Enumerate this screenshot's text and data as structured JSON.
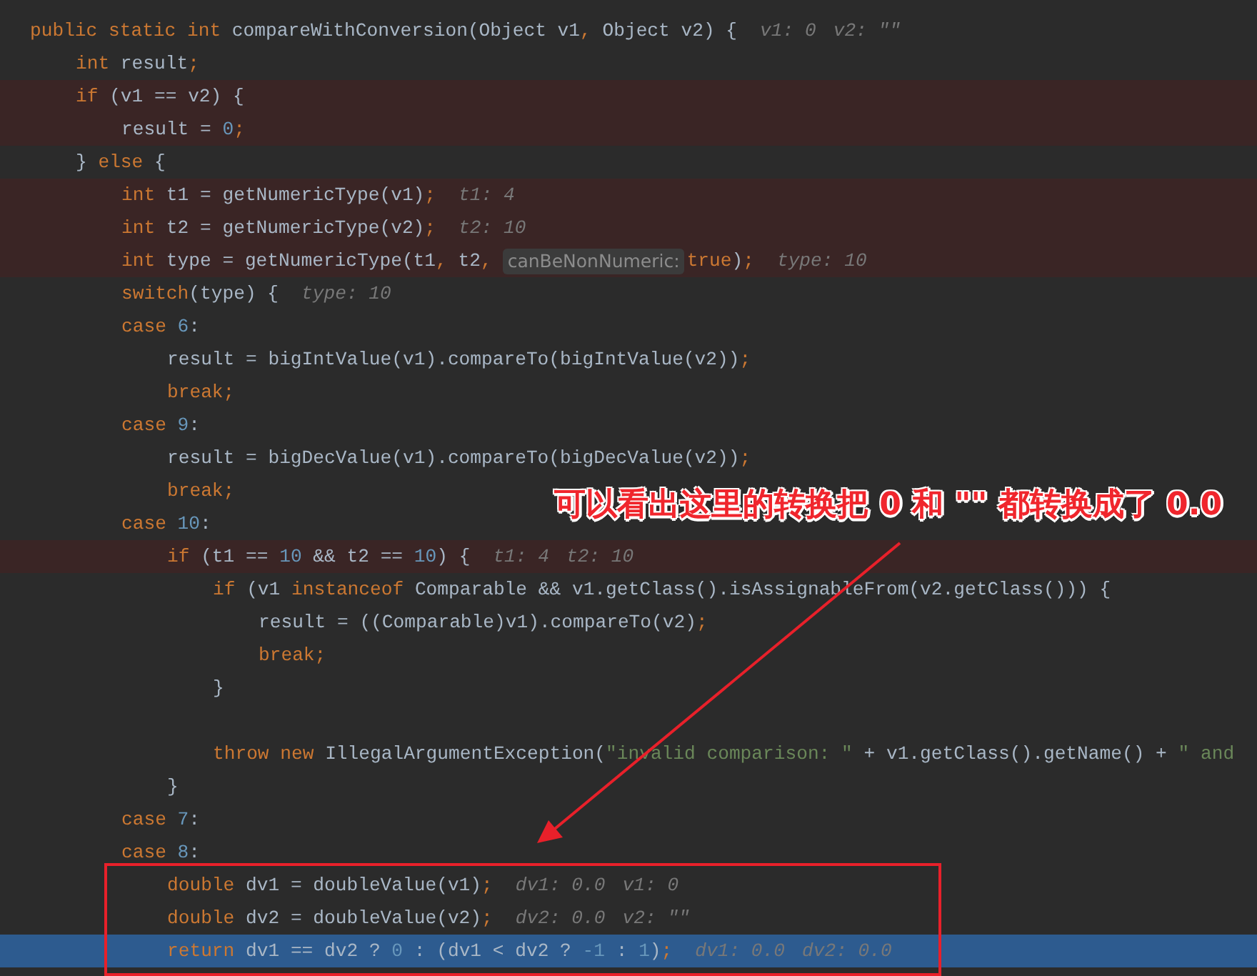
{
  "code": {
    "lines": [
      {
        "kind": "code",
        "highlighted": false,
        "selected": false,
        "tokens": [
          {
            "kind": "kw",
            "text": "public static int"
          },
          {
            "kind": "pl",
            "text": " compareWithConversion(Object v1"
          },
          {
            "kind": "kw",
            "text": ","
          },
          {
            "kind": "pl",
            "text": " Object v2) {"
          }
        ],
        "hints": [
          "v1: 0",
          "v2: \"\""
        ],
        "children": [
          {
            "kind": "code",
            "highlighted": false,
            "selected": false,
            "tokens": [
              {
                "kind": "kw",
                "text": "int"
              },
              {
                "kind": "pl",
                "text": " result"
              },
              {
                "kind": "kw",
                "text": ";"
              }
            ]
          },
          {
            "kind": "code",
            "highlighted": true,
            "selected": false,
            "tokens": [
              {
                "kind": "kw",
                "text": "if"
              },
              {
                "kind": "pl",
                "text": " (v1 == v2) {"
              }
            ],
            "children": [
              {
                "kind": "code",
                "highlighted": true,
                "selected": false,
                "tokens": [
                  {
                    "kind": "pl",
                    "text": "result = "
                  },
                  {
                    "kind": "num",
                    "text": "0"
                  },
                  {
                    "kind": "kw",
                    "text": ";"
                  }
                ]
              }
            ]
          },
          {
            "kind": "code",
            "highlighted": false,
            "selected": false,
            "tokens": [
              {
                "kind": "pl",
                "text": "} "
              },
              {
                "kind": "kw",
                "text": "else"
              },
              {
                "kind": "pl",
                "text": " {"
              }
            ],
            "children": [
              {
                "kind": "code",
                "highlighted": true,
                "selected": false,
                "tokens": [
                  {
                    "kind": "kw",
                    "text": "int"
                  },
                  {
                    "kind": "pl",
                    "text": " t1 = getNumericType(v1)"
                  },
                  {
                    "kind": "kw",
                    "text": ";"
                  }
                ],
                "hints": [
                  "t1: 4"
                ]
              },
              {
                "kind": "code",
                "highlighted": true,
                "selected": false,
                "tokens": [
                  {
                    "kind": "kw",
                    "text": "int"
                  },
                  {
                    "kind": "pl",
                    "text": " t2 = getNumericType(v2)"
                  },
                  {
                    "kind": "kw",
                    "text": ";"
                  }
                ],
                "hints": [
                  "t2: 10"
                ]
              },
              {
                "kind": "code",
                "highlighted": true,
                "selected": false,
                "tokens": [
                  {
                    "kind": "kw",
                    "text": "int"
                  },
                  {
                    "kind": "pl",
                    "text": " type = getNumericType(t1"
                  },
                  {
                    "kind": "kw",
                    "text": ","
                  },
                  {
                    "kind": "pl",
                    "text": " t2"
                  },
                  {
                    "kind": "kw",
                    "text": ","
                  },
                  {
                    "kind": "param",
                    "text": "canBeNonNumeric:"
                  },
                  {
                    "kind": "kw",
                    "text": "true"
                  },
                  {
                    "kind": "pl",
                    "text": ")"
                  },
                  {
                    "kind": "kw",
                    "text": ";"
                  }
                ],
                "hints": [
                  "type: 10"
                ]
              },
              {
                "kind": "code",
                "highlighted": false,
                "selected": false,
                "tokens": [
                  {
                    "kind": "kw",
                    "text": "switch"
                  },
                  {
                    "kind": "pl",
                    "text": "(type) {"
                  }
                ],
                "hints": [
                  "type: 10"
                ]
              },
              {
                "kind": "code",
                "highlighted": false,
                "selected": false,
                "tokens": [
                  {
                    "kind": "kw",
                    "text": "case"
                  },
                  {
                    "kind": "num",
                    "text": " 6"
                  },
                  {
                    "kind": "pl",
                    "text": ":"
                  }
                ],
                "children": [
                  {
                    "kind": "code",
                    "highlighted": false,
                    "selected": false,
                    "tokens": [
                      {
                        "kind": "pl",
                        "text": "result = bigIntValue(v1).compareTo(bigIntValue(v2))"
                      },
                      {
                        "kind": "kw",
                        "text": ";"
                      }
                    ]
                  },
                  {
                    "kind": "code",
                    "highlighted": false,
                    "selected": false,
                    "tokens": [
                      {
                        "kind": "kw",
                        "text": "break;"
                      }
                    ]
                  }
                ]
              },
              {
                "kind": "code",
                "highlighted": false,
                "selected": false,
                "tokens": [
                  {
                    "kind": "kw",
                    "text": "case"
                  },
                  {
                    "kind": "num",
                    "text": " 9"
                  },
                  {
                    "kind": "pl",
                    "text": ":"
                  }
                ],
                "children": [
                  {
                    "kind": "code",
                    "highlighted": false,
                    "selected": false,
                    "tokens": [
                      {
                        "kind": "pl",
                        "text": "result = bigDecValue(v1).compareTo(bigDecValue(v2))"
                      },
                      {
                        "kind": "kw",
                        "text": ";"
                      }
                    ]
                  },
                  {
                    "kind": "code",
                    "highlighted": false,
                    "selected": false,
                    "tokens": [
                      {
                        "kind": "kw",
                        "text": "break;"
                      }
                    ]
                  }
                ]
              },
              {
                "kind": "code",
                "highlighted": false,
                "selected": false,
                "tokens": [
                  {
                    "kind": "kw",
                    "text": "case"
                  },
                  {
                    "kind": "num",
                    "text": " 10"
                  },
                  {
                    "kind": "pl",
                    "text": ":"
                  }
                ],
                "children": [
                  {
                    "kind": "code",
                    "highlighted": true,
                    "selected": false,
                    "tokens": [
                      {
                        "kind": "kw",
                        "text": "if"
                      },
                      {
                        "kind": "pl",
                        "text": " (t1 == "
                      },
                      {
                        "kind": "num",
                        "text": "10"
                      },
                      {
                        "kind": "pl",
                        "text": " && t2 == "
                      },
                      {
                        "kind": "num",
                        "text": "10"
                      },
                      {
                        "kind": "pl",
                        "text": ") {"
                      }
                    ],
                    "hints": [
                      "t1: 4",
                      "t2: 10"
                    ],
                    "children": [
                      {
                        "kind": "code",
                        "highlighted": false,
                        "selected": false,
                        "tokens": [
                          {
                            "kind": "kw",
                            "text": "if"
                          },
                          {
                            "kind": "pl",
                            "text": " (v1 "
                          },
                          {
                            "kind": "kw",
                            "text": "instanceof"
                          },
                          {
                            "kind": "pl",
                            "text": " Comparable && v1.getClass().isAssignableFrom(v2.getClass())) {"
                          }
                        ],
                        "children": [
                          {
                            "kind": "code",
                            "highlighted": false,
                            "selected": false,
                            "tokens": [
                              {
                                "kind": "pl",
                                "text": "result = ((Comparable)v1).compareTo(v2)"
                              },
                              {
                                "kind": "kw",
                                "text": ";"
                              }
                            ]
                          },
                          {
                            "kind": "code",
                            "highlighted": false,
                            "selected": false,
                            "tokens": [
                              {
                                "kind": "kw",
                                "text": "break;"
                              }
                            ]
                          }
                        ]
                      },
                      {
                        "kind": "code",
                        "highlighted": false,
                        "selected": false,
                        "tokens": [
                          {
                            "kind": "pl",
                            "text": "}"
                          }
                        ]
                      },
                      {
                        "kind": "blank"
                      },
                      {
                        "kind": "code",
                        "highlighted": false,
                        "selected": false,
                        "tokens": [
                          {
                            "kind": "kw",
                            "text": "throw new"
                          },
                          {
                            "kind": "pl",
                            "text": " IllegalArgumentException("
                          },
                          {
                            "kind": "str",
                            "text": "\"invalid comparison: \""
                          },
                          {
                            "kind": "pl",
                            "text": " + v1.getClass().getName() + "
                          },
                          {
                            "kind": "str",
                            "text": "\" and"
                          }
                        ]
                      }
                    ]
                  },
                  {
                    "kind": "code",
                    "highlighted": false,
                    "selected": false,
                    "tokens": [
                      {
                        "kind": "pl",
                        "text": "}"
                      }
                    ]
                  }
                ]
              },
              {
                "kind": "code",
                "highlighted": false,
                "selected": false,
                "tokens": [
                  {
                    "kind": "kw",
                    "text": "case"
                  },
                  {
                    "kind": "num",
                    "text": " 7"
                  },
                  {
                    "kind": "pl",
                    "text": ":"
                  }
                ]
              },
              {
                "kind": "code",
                "highlighted": false,
                "selected": false,
                "tokens": [
                  {
                    "kind": "kw",
                    "text": "case"
                  },
                  {
                    "kind": "num",
                    "text": " 8"
                  },
                  {
                    "kind": "pl",
                    "text": ":"
                  }
                ],
                "children": [
                  {
                    "kind": "code",
                    "highlighted": false,
                    "selected": false,
                    "tokens": [
                      {
                        "kind": "kw",
                        "text": "double"
                      },
                      {
                        "kind": "pl",
                        "text": " dv1 = doubleValue(v1)"
                      },
                      {
                        "kind": "kw",
                        "text": ";"
                      }
                    ],
                    "hints": [
                      "dv1: 0.0",
                      "v1: 0"
                    ]
                  },
                  {
                    "kind": "code",
                    "highlighted": false,
                    "selected": false,
                    "tokens": [
                      {
                        "kind": "kw",
                        "text": "double"
                      },
                      {
                        "kind": "pl",
                        "text": " dv2 = doubleValue(v2)"
                      },
                      {
                        "kind": "kw",
                        "text": ";"
                      }
                    ],
                    "hints": [
                      "dv2: 0.0",
                      "v2: \"\""
                    ]
                  },
                  {
                    "kind": "code",
                    "highlighted": false,
                    "selected": true,
                    "tokens": [
                      {
                        "kind": "kw",
                        "text": "return"
                      },
                      {
                        "kind": "pl",
                        "text": " dv1 == dv2 ? "
                      },
                      {
                        "kind": "num",
                        "text": "0"
                      },
                      {
                        "kind": "pl",
                        "text": " : (dv1 < dv2 ? "
                      },
                      {
                        "kind": "num",
                        "text": "-1"
                      },
                      {
                        "kind": "pl",
                        "text": " : "
                      },
                      {
                        "kind": "num",
                        "text": "1"
                      },
                      {
                        "kind": "pl",
                        "text": ")"
                      },
                      {
                        "kind": "kw",
                        "text": ";"
                      }
                    ],
                    "hints": [
                      "dv1: 0.0",
                      "dv2: 0.0"
                    ]
                  }
                ]
              }
            ]
          }
        ]
      }
    ]
  },
  "annotation": {
    "text": "可以看出这里的转换把 0 和 \"\" 都转换成了 0.0"
  }
}
